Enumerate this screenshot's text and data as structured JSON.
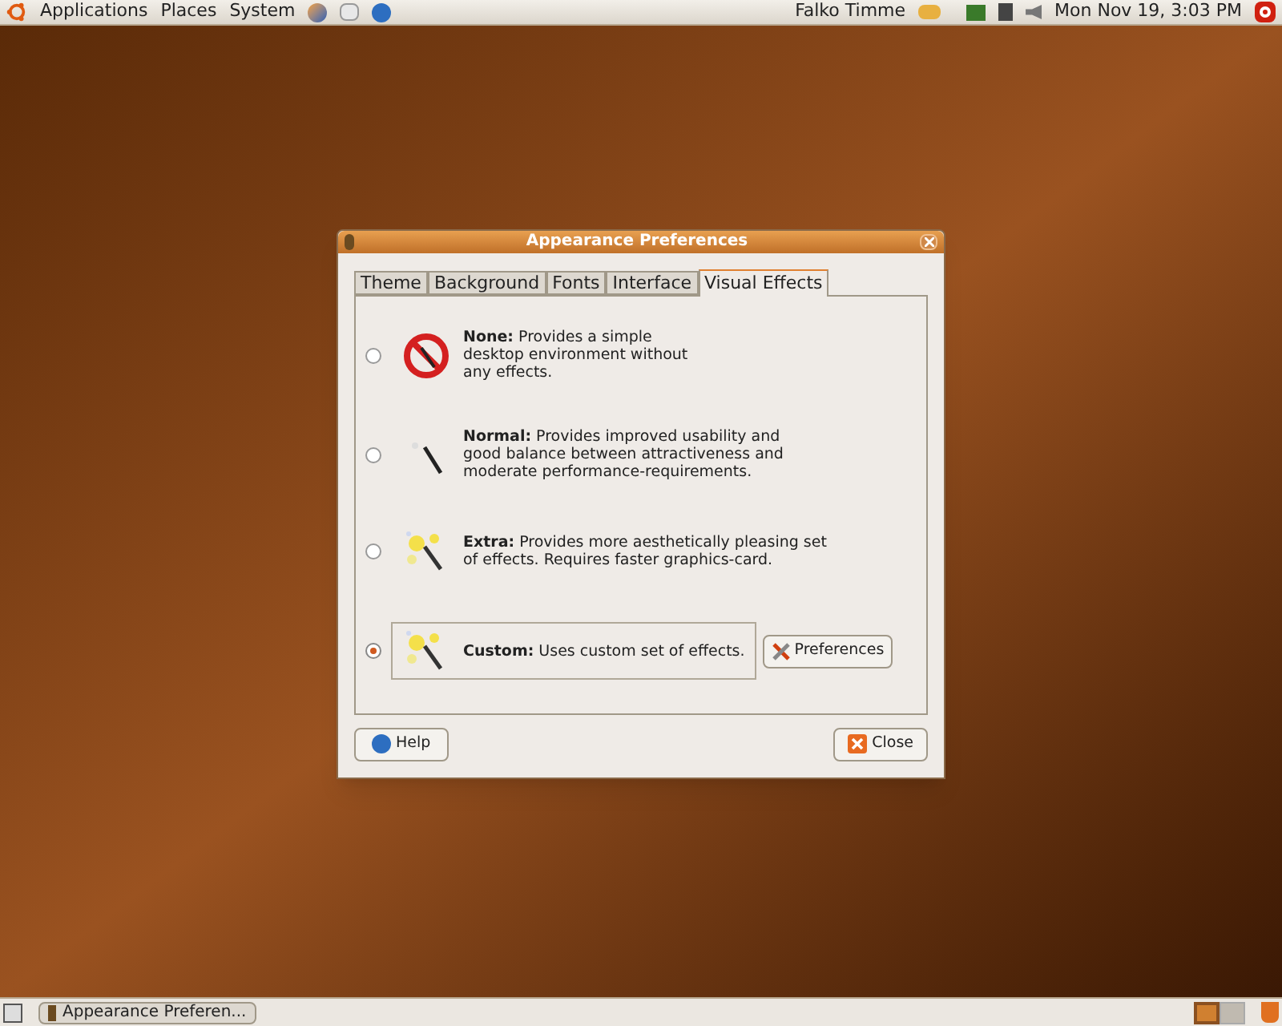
{
  "top_panel": {
    "menus": [
      "Applications",
      "Places",
      "System"
    ],
    "user": "Falko Timme",
    "clock": "Mon Nov 19,  3:03 PM"
  },
  "window": {
    "title": "Appearance Preferences",
    "tabs": [
      {
        "label": "Theme",
        "selected": false
      },
      {
        "label": "Background",
        "selected": false
      },
      {
        "label": "Fonts",
        "selected": false
      },
      {
        "label": "Interface",
        "selected": false
      },
      {
        "label": "Visual Effects",
        "selected": true
      }
    ],
    "options": [
      {
        "kind": "none",
        "text": "**None:** Provides a simple\ndesktop environment without\nany effects.",
        "selected": false
      },
      {
        "kind": "normal",
        "text": "**Normal:** Provides improved usability and\ngood balance between attractiveness and\nmoderate performance-requirements.",
        "selected": false
      },
      {
        "kind": "extra",
        "text": "**Extra:** Provides more aesthetically pleasing set\nof effects. Requires faster graphics-card.",
        "selected": false
      },
      {
        "kind": "custom",
        "text": "**Custom:** Uses custom set of effects.",
        "selected": true,
        "button": "Preferences"
      }
    ],
    "help_button": "Help",
    "close_button": "Close"
  },
  "bottom_panel": {
    "task": "Appearance Preferen...",
    "workspaces": [
      {
        "selected": true
      },
      {
        "selected": false
      }
    ]
  }
}
